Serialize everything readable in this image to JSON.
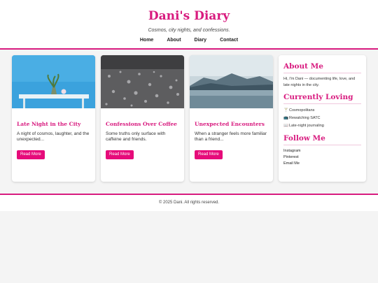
{
  "header": {
    "title": "Dani's Diary",
    "tagline": "Cosmos, city nights, and confessions.",
    "nav": [
      "Home",
      "About",
      "Diary",
      "Contact"
    ]
  },
  "posts": [
    {
      "title": "Late Night in the City",
      "excerpt": "A night of cosmos, laughter, and the unexpected...",
      "button": "Read More"
    },
    {
      "title": "Confessions Over Coffee",
      "excerpt": "Some truths only surface with caffeine and friends.",
      "button": "Read More"
    },
    {
      "title": "Unexpected Encounters",
      "excerpt": "When a stranger feels more familiar than a friend...",
      "button": "Read More"
    }
  ],
  "sidebar": {
    "about_title": "About Me",
    "about_text": "Hi, I'm Dani — documenting life, love, and late nights in the city.",
    "loving_title": "Currently Loving",
    "loving": [
      {
        "icon": "🍸",
        "label": "Cosmopolitans"
      },
      {
        "icon": "📺",
        "label": "Rewatching SATC"
      },
      {
        "icon": "📖",
        "label": "Late-night journaling"
      }
    ],
    "follow_title": "Follow Me",
    "follow": [
      "Instagram",
      "Pinterest",
      "Email Me"
    ]
  },
  "footer": {
    "text": "© 2025 Dani. All rights reserved."
  },
  "colors": {
    "accent": "#d81b7f",
    "button": "#e60b7a"
  }
}
